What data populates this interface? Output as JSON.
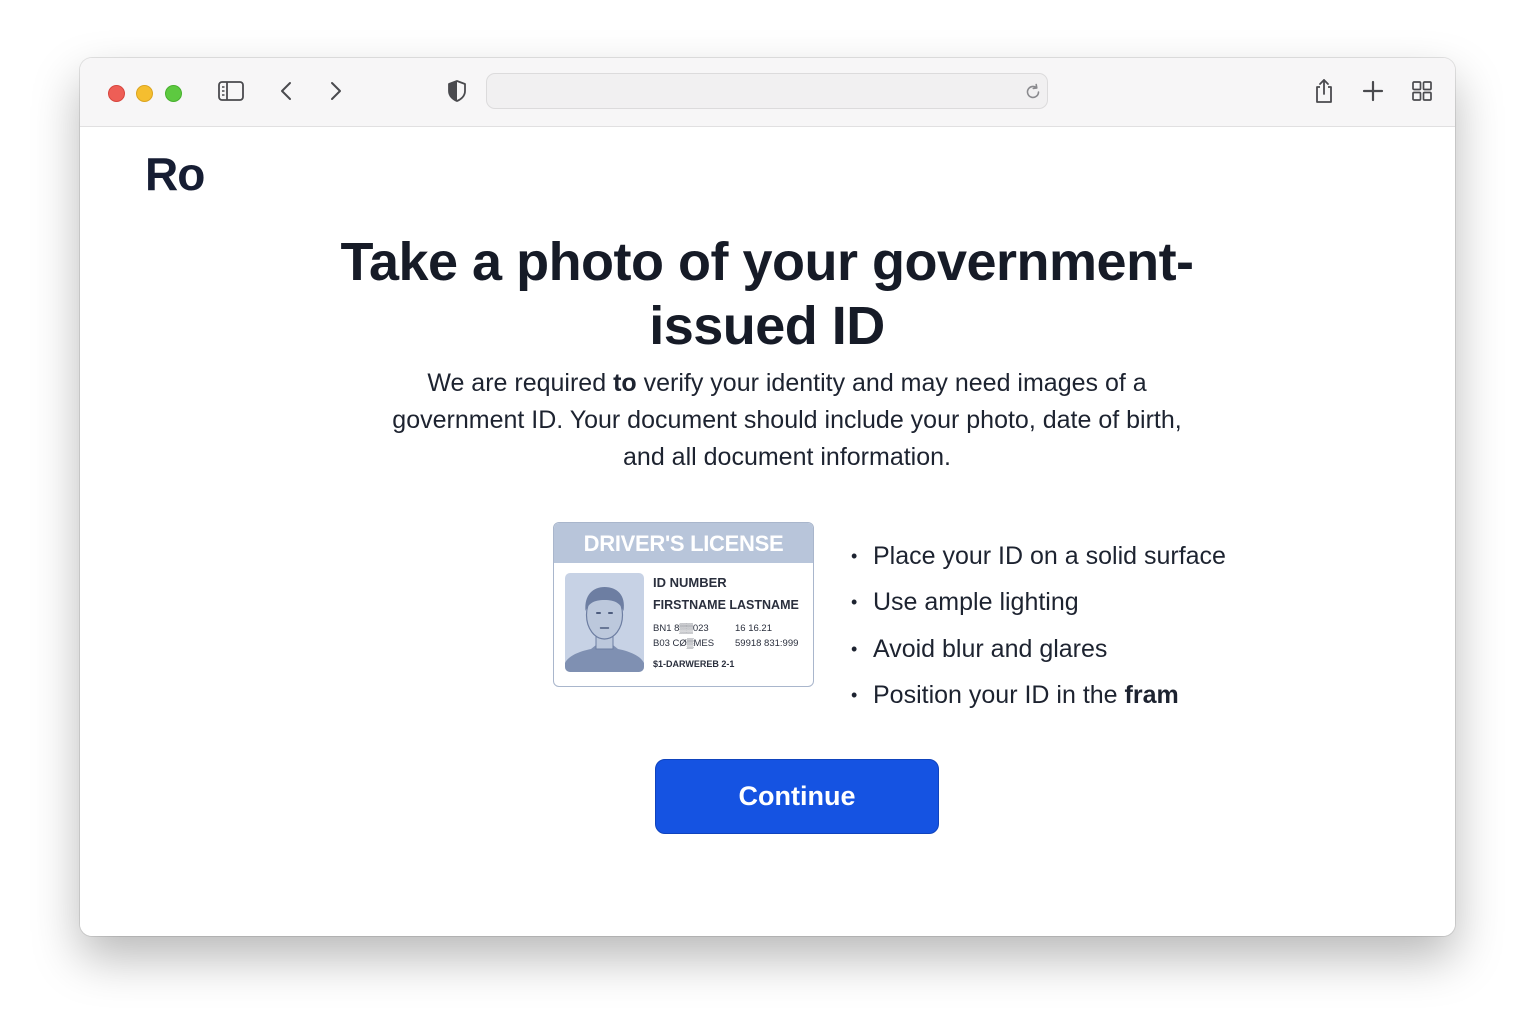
{
  "browser": {
    "url": "",
    "icons": {
      "sidebar": "sidebar-icon",
      "back": "chevron-left-icon",
      "forward": "chevron-right-icon",
      "privacy": "shield-icon",
      "reload": "reload-icon",
      "share": "share-icon",
      "new_tab": "plus-icon",
      "tab_overview": "grid-icon"
    },
    "traffic_light_colors": [
      "#ee5e56",
      "#f5be2f",
      "#5dc940"
    ]
  },
  "page": {
    "logo": "Ro",
    "headline": "Take a photo of your government-issued ID",
    "description": {
      "part1": "We are required ",
      "bold": "to",
      "part2": " verify your identity and may need images of a government ID. Your document should include your photo, date of birth, and all document information."
    },
    "id_card": {
      "header": "DRIVER'S LICENSE",
      "id_number": "ID NUMBER",
      "name": "FIRSTNAME LASTNAME",
      "line1_left": "BN1 8▒▒023",
      "line1_right": "16 16.21",
      "line2_left": "B03 CØ▒MES",
      "line2_right": "59918 831:999",
      "line3": "$1-DARWEREB 2-1"
    },
    "tips": [
      {
        "text": "Place your ID on a solid surface",
        "bold": ""
      },
      {
        "text": "Use ample lighting",
        "bold": ""
      },
      {
        "text": "Avoid blur and glares",
        "bold": ""
      },
      {
        "text": "Position your ID in the ",
        "bold": "fram"
      }
    ],
    "continue_label": "Continue",
    "accent_color": "#1553e2"
  }
}
